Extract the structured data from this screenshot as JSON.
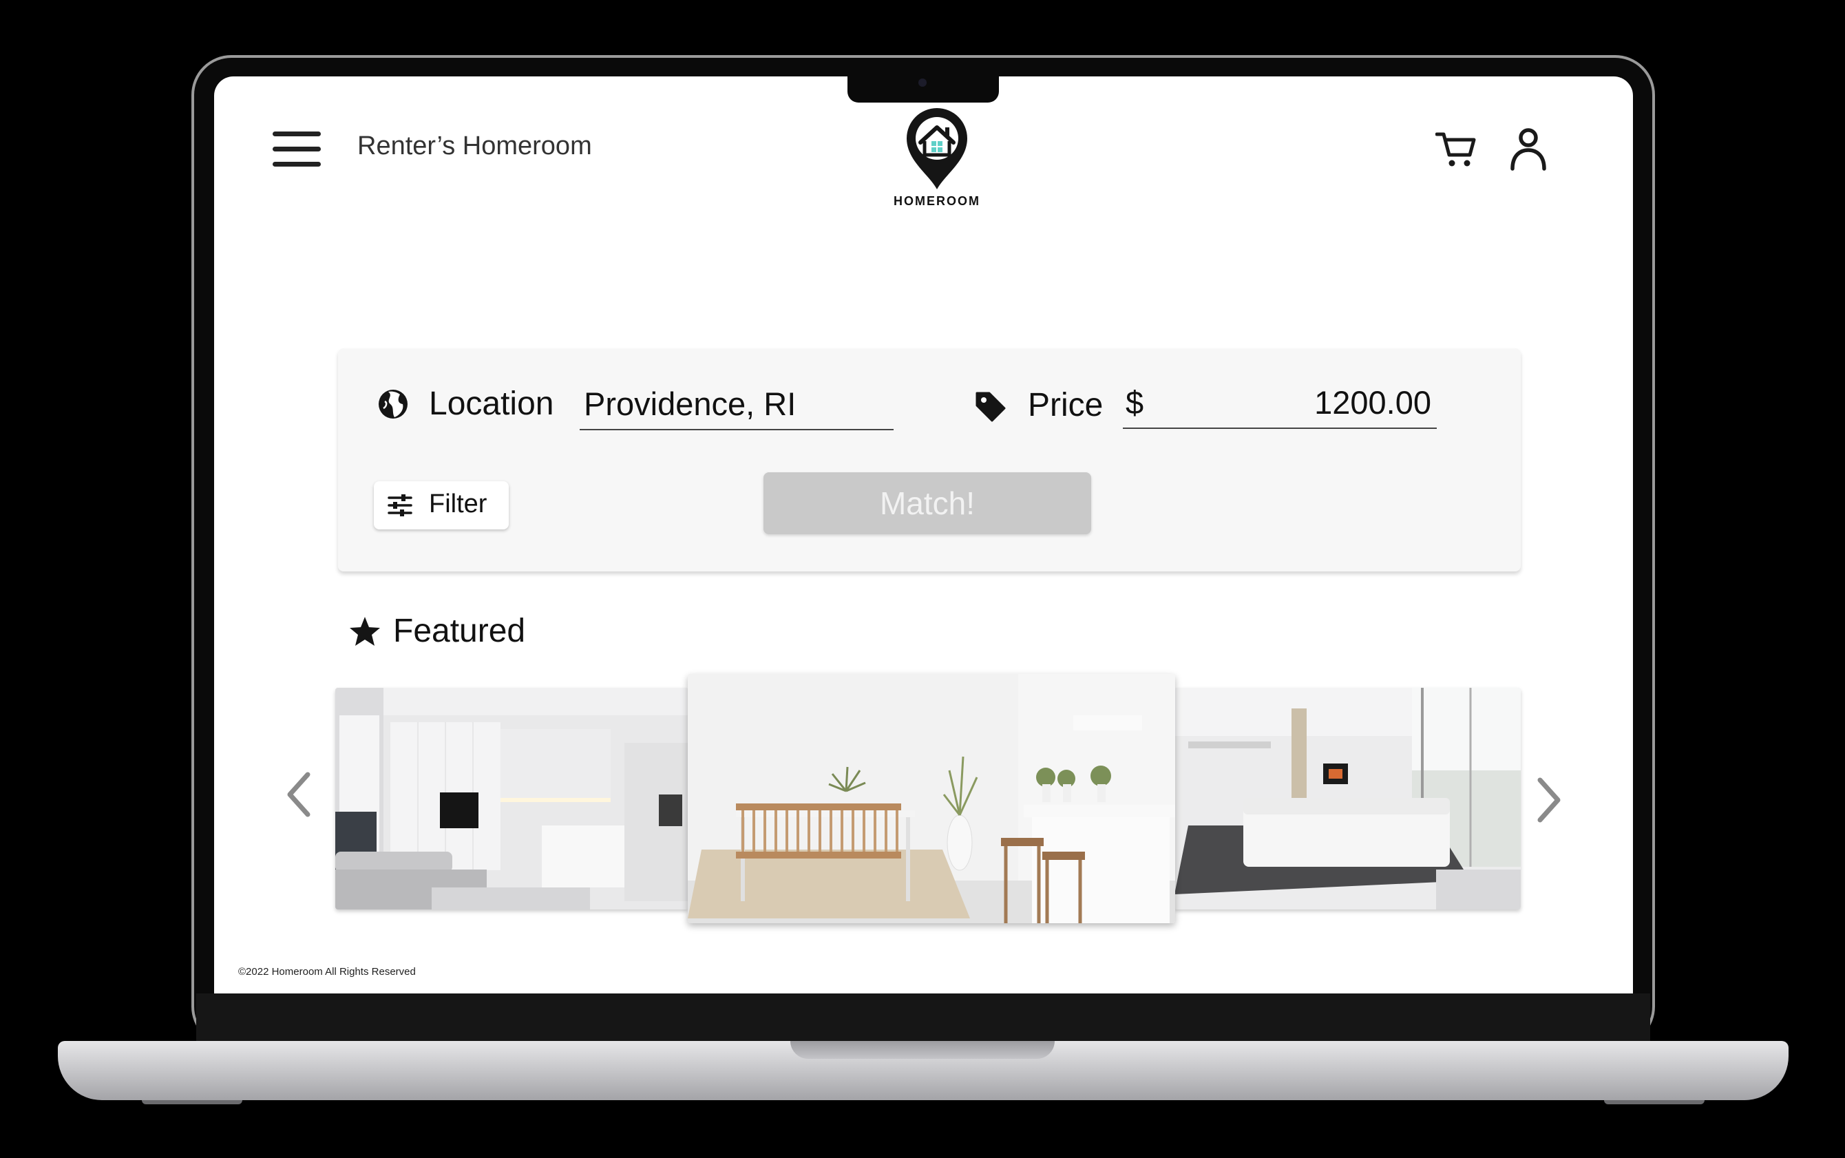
{
  "header": {
    "app_name": "Renter’s Homeroom",
    "logo_text": "HOMEROOM"
  },
  "search": {
    "location_label": "Location",
    "location_value": "Providence, RI",
    "price_label": "Price",
    "price_currency": "$",
    "price_value": "1200.00",
    "filter_label": "Filter",
    "match_label": "Match!"
  },
  "featured": {
    "title": "Featured",
    "listings": [
      {
        "name": "listing-photo-living-kitchen"
      },
      {
        "name": "listing-photo-dining"
      },
      {
        "name": "listing-photo-lounge"
      }
    ]
  },
  "footer": {
    "copyright": "©2022 Homeroom All Rights Reserved"
  },
  "colors": {
    "accent": "#5fd0c8",
    "match_button": "#c9c9c9",
    "card_bg": "#f7f7f7"
  },
  "icons": [
    "hamburger-icon",
    "homeroom-logo",
    "cart-icon",
    "user-icon",
    "globe-icon",
    "price-tag-icon",
    "sliders-icon",
    "star-icon",
    "chevron-left-icon",
    "chevron-right-icon"
  ]
}
